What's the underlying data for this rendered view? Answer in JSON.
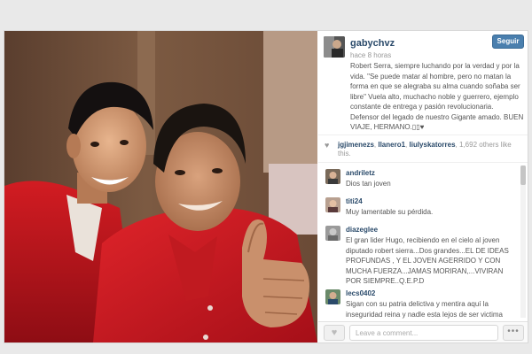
{
  "post": {
    "username": "gabychvz",
    "follow_label": "Seguir",
    "time": "hace 8 horas",
    "caption": "Robert Serra, siempre luchando por la verdad y por la vida. \"Se puede matar al hombre, pero no matan la forma en que se alegraba su alma cuando soñaba ser libre\" Vuela alto, muchacho noble y guerrero, ejemplo constante de entrega y pasión revolucionaria. Defensor del legado de nuestro Gigante amado. BUEN VIAJE, HERMANO.▯▯♥"
  },
  "likes": {
    "names": [
      "jgjimenezs",
      "llanero1",
      "liulyskatorres"
    ],
    "count_text": "1,692 others like this.",
    "separator": ", ",
    "connector": ","
  },
  "comments": [
    {
      "user": "andriletz",
      "text": "Dios tan joven"
    },
    {
      "user": "titi24",
      "text": "Muy lamentable su pérdida."
    },
    {
      "user": "diazeglee",
      "text": "El gran lider Hugo, recibiendo en el cielo al joven diputado robert sierra...Dos grandes...EL DE IDEAS PROFUNDAS , Y EL JOVEN AGERRIDO Y CON MUCHA FUERZA...JAMAS MORIRAN,...VIVIRAN POR SIEMPRE..Q.E.P.D"
    },
    {
      "user": "lecs0402",
      "text": "Sigan con su patria delictiva y mentira aquí la inseguridad reina y nadle esta lejos de ser victima"
    }
  ],
  "footer": {
    "comment_placeholder": "Leave a comment...",
    "more_label": "•••"
  },
  "icons": {
    "heart": "heart-icon",
    "like": "like-heart-icon",
    "more": "more-dots-icon"
  },
  "colors": {
    "follow_button": "#4a7fae",
    "username": "#2a4a6a",
    "shirt_red": "#c8141e"
  }
}
